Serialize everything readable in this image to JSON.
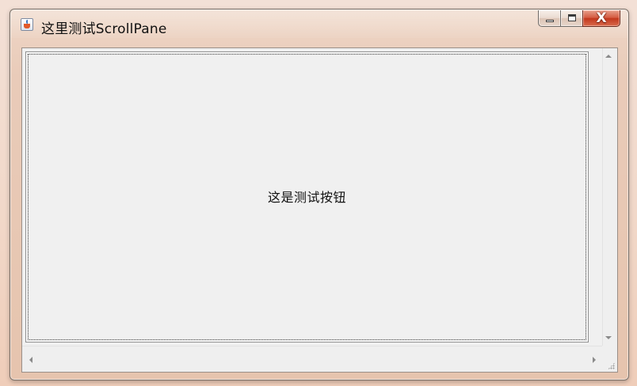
{
  "window": {
    "title": "这里测试ScrollPane",
    "controls": {
      "minimize": "minimize",
      "maximize": "maximize",
      "close": "X"
    }
  },
  "content": {
    "button_label": "这是测试按钮"
  },
  "icons": {
    "app": "java-coffee-cup-icon",
    "scroll_up": "arrow-up-icon",
    "scroll_down": "arrow-down-icon",
    "scroll_left": "arrow-left-icon",
    "scroll_right": "arrow-right-icon",
    "resize_grip": "resize-grip-icon"
  },
  "colors": {
    "frame_tint": "#e9cbb9",
    "close_button": "#c2371d",
    "client_background": "#f0f0f0"
  }
}
